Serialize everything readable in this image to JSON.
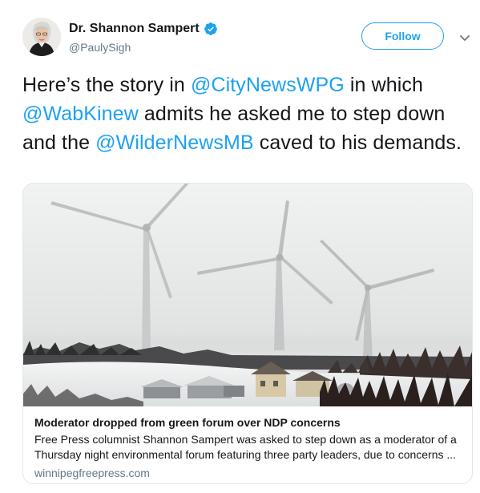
{
  "author": {
    "display_name": "Dr. Shannon Sampert",
    "handle": "@PaulySigh",
    "verified_icon": "verified-badge-icon"
  },
  "actions": {
    "follow_label": "Follow",
    "more_icon": "chevron-down-icon"
  },
  "tweet": {
    "segments": [
      {
        "text": "Here’s the story in ",
        "mention": false
      },
      {
        "text": "@CityNewsWPG",
        "mention": true
      },
      {
        "text": " in which ",
        "mention": false
      },
      {
        "text": "@WabKinew",
        "mention": true
      },
      {
        "text": " admits he asked me to step down and the ",
        "mention": false
      },
      {
        "text": "@WilderNewsMB",
        "mention": true
      },
      {
        "text": " caved to his demands.",
        "mention": false
      }
    ]
  },
  "card": {
    "title": "Moderator dropped from green forum over NDP concerns",
    "description_line1": "Free Press columnist Shannon Sampert was asked to step down as a moderator of a",
    "description_line2": "Thursday night environmental forum featuring three party leaders, due to concerns ...",
    "domain": "winnipegfreepress.com"
  },
  "colors": {
    "accent": "#1da1f2",
    "text": "#14171a",
    "secondary": "#657786",
    "border": "#e1e8ed"
  }
}
